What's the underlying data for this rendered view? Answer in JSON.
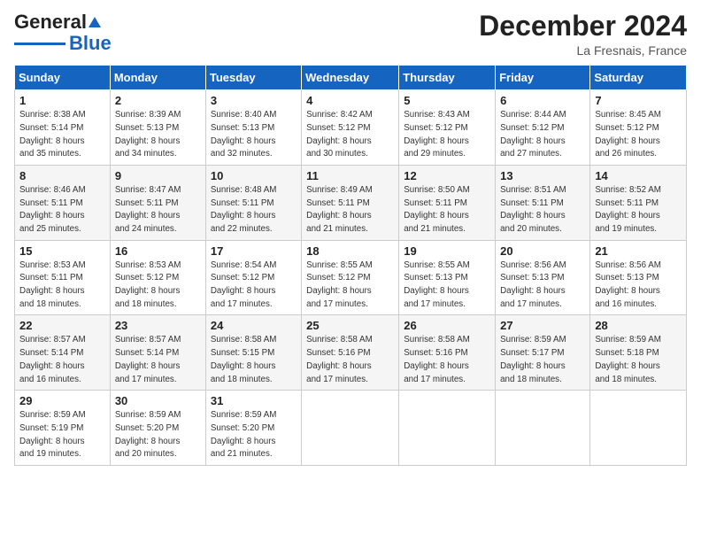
{
  "logo": {
    "general": "General",
    "blue": "Blue"
  },
  "header": {
    "month": "December 2024",
    "location": "La Fresnais, France"
  },
  "weekdays": [
    "Sunday",
    "Monday",
    "Tuesday",
    "Wednesday",
    "Thursday",
    "Friday",
    "Saturday"
  ],
  "weeks": [
    [
      {
        "day": "1",
        "sunrise": "8:38 AM",
        "sunset": "5:14 PM",
        "daylight": "8 hours and 35 minutes."
      },
      {
        "day": "2",
        "sunrise": "8:39 AM",
        "sunset": "5:13 PM",
        "daylight": "8 hours and 34 minutes."
      },
      {
        "day": "3",
        "sunrise": "8:40 AM",
        "sunset": "5:13 PM",
        "daylight": "8 hours and 32 minutes."
      },
      {
        "day": "4",
        "sunrise": "8:42 AM",
        "sunset": "5:12 PM",
        "daylight": "8 hours and 30 minutes."
      },
      {
        "day": "5",
        "sunrise": "8:43 AM",
        "sunset": "5:12 PM",
        "daylight": "8 hours and 29 minutes."
      },
      {
        "day": "6",
        "sunrise": "8:44 AM",
        "sunset": "5:12 PM",
        "daylight": "8 hours and 27 minutes."
      },
      {
        "day": "7",
        "sunrise": "8:45 AM",
        "sunset": "5:12 PM",
        "daylight": "8 hours and 26 minutes."
      }
    ],
    [
      {
        "day": "8",
        "sunrise": "8:46 AM",
        "sunset": "5:11 PM",
        "daylight": "8 hours and 25 minutes."
      },
      {
        "day": "9",
        "sunrise": "8:47 AM",
        "sunset": "5:11 PM",
        "daylight": "8 hours and 24 minutes."
      },
      {
        "day": "10",
        "sunrise": "8:48 AM",
        "sunset": "5:11 PM",
        "daylight": "8 hours and 22 minutes."
      },
      {
        "day": "11",
        "sunrise": "8:49 AM",
        "sunset": "5:11 PM",
        "daylight": "8 hours and 21 minutes."
      },
      {
        "day": "12",
        "sunrise": "8:50 AM",
        "sunset": "5:11 PM",
        "daylight": "8 hours and 21 minutes."
      },
      {
        "day": "13",
        "sunrise": "8:51 AM",
        "sunset": "5:11 PM",
        "daylight": "8 hours and 20 minutes."
      },
      {
        "day": "14",
        "sunrise": "8:52 AM",
        "sunset": "5:11 PM",
        "daylight": "8 hours and 19 minutes."
      }
    ],
    [
      {
        "day": "15",
        "sunrise": "8:53 AM",
        "sunset": "5:11 PM",
        "daylight": "8 hours and 18 minutes."
      },
      {
        "day": "16",
        "sunrise": "8:53 AM",
        "sunset": "5:12 PM",
        "daylight": "8 hours and 18 minutes."
      },
      {
        "day": "17",
        "sunrise": "8:54 AM",
        "sunset": "5:12 PM",
        "daylight": "8 hours and 17 minutes."
      },
      {
        "day": "18",
        "sunrise": "8:55 AM",
        "sunset": "5:12 PM",
        "daylight": "8 hours and 17 minutes."
      },
      {
        "day": "19",
        "sunrise": "8:55 AM",
        "sunset": "5:13 PM",
        "daylight": "8 hours and 17 minutes."
      },
      {
        "day": "20",
        "sunrise": "8:56 AM",
        "sunset": "5:13 PM",
        "daylight": "8 hours and 17 minutes."
      },
      {
        "day": "21",
        "sunrise": "8:56 AM",
        "sunset": "5:13 PM",
        "daylight": "8 hours and 16 minutes."
      }
    ],
    [
      {
        "day": "22",
        "sunrise": "8:57 AM",
        "sunset": "5:14 PM",
        "daylight": "8 hours and 16 minutes."
      },
      {
        "day": "23",
        "sunrise": "8:57 AM",
        "sunset": "5:14 PM",
        "daylight": "8 hours and 17 minutes."
      },
      {
        "day": "24",
        "sunrise": "8:58 AM",
        "sunset": "5:15 PM",
        "daylight": "8 hours and 18 minutes."
      },
      {
        "day": "25",
        "sunrise": "8:58 AM",
        "sunset": "5:16 PM",
        "daylight": "8 hours and 17 minutes."
      },
      {
        "day": "26",
        "sunrise": "8:58 AM",
        "sunset": "5:16 PM",
        "daylight": "8 hours and 17 minutes."
      },
      {
        "day": "27",
        "sunrise": "8:59 AM",
        "sunset": "5:17 PM",
        "daylight": "8 hours and 18 minutes."
      },
      {
        "day": "28",
        "sunrise": "8:59 AM",
        "sunset": "5:18 PM",
        "daylight": "8 hours and 18 minutes."
      }
    ],
    [
      {
        "day": "29",
        "sunrise": "8:59 AM",
        "sunset": "5:19 PM",
        "daylight": "8 hours and 19 minutes."
      },
      {
        "day": "30",
        "sunrise": "8:59 AM",
        "sunset": "5:20 PM",
        "daylight": "8 hours and 20 minutes."
      },
      {
        "day": "31",
        "sunrise": "8:59 AM",
        "sunset": "5:20 PM",
        "daylight": "8 hours and 21 minutes."
      },
      null,
      null,
      null,
      null
    ]
  ]
}
